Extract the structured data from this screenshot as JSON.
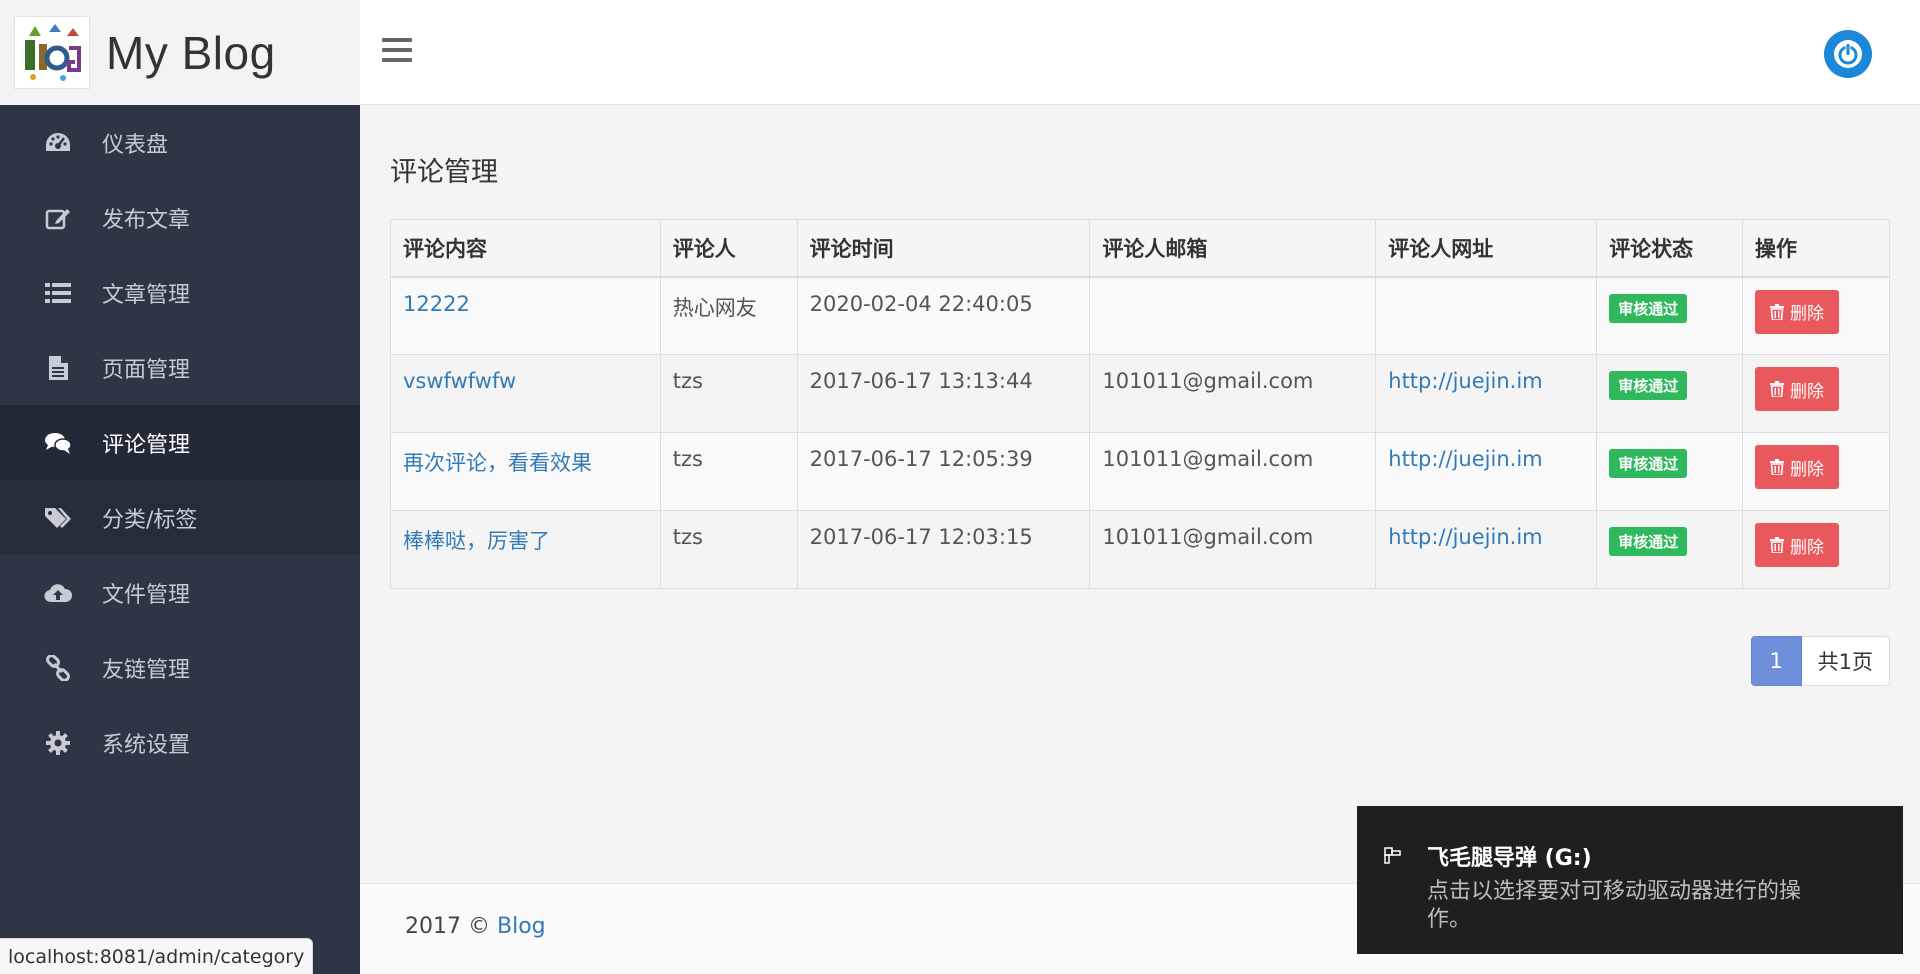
{
  "brand": {
    "name": "My Blog"
  },
  "sidebar": {
    "items": [
      {
        "label": "仪表盘",
        "icon": "dashboard-icon"
      },
      {
        "label": "发布文章",
        "icon": "edit-icon"
      },
      {
        "label": "文章管理",
        "icon": "list-icon"
      },
      {
        "label": "页面管理",
        "icon": "file-icon"
      },
      {
        "label": "评论管理",
        "icon": "comments-icon"
      },
      {
        "label": "分类/标签",
        "icon": "tags-icon"
      },
      {
        "label": "文件管理",
        "icon": "cloud-upload-icon"
      },
      {
        "label": "友链管理",
        "icon": "link-icon"
      },
      {
        "label": "系统设置",
        "icon": "gear-icon"
      }
    ]
  },
  "main": {
    "title": "评论管理",
    "table": {
      "headers": [
        "评论内容",
        "评论人",
        "评论时间",
        "评论人邮箱",
        "评论人网址",
        "评论状态",
        "操作"
      ],
      "rows": [
        {
          "content": "12222",
          "author": "热心网友",
          "time": "2020-02-04 22:40:05",
          "email": "",
          "url": "",
          "status": "审核通过",
          "action": "删除"
        },
        {
          "content": "vswfwfwfw",
          "author": "tzs",
          "time": "2017-06-17 13:13:44",
          "email": "101011@gmail.com",
          "url": "http://juejin.im",
          "status": "审核通过",
          "action": "删除"
        },
        {
          "content": "再次评论，看看效果",
          "author": "tzs",
          "time": "2017-06-17 12:05:39",
          "email": "101011@gmail.com",
          "url": "http://juejin.im",
          "status": "审核通过",
          "action": "删除"
        },
        {
          "content": "棒棒哒，厉害了",
          "author": "tzs",
          "time": "2017-06-17 12:03:15",
          "email": "101011@gmail.com",
          "url": "http://juejin.im",
          "status": "审核通过",
          "action": "删除"
        }
      ]
    },
    "pagination": {
      "current": "1",
      "total": "共1页"
    }
  },
  "footer": {
    "year": "2017 ©",
    "link": "Blog"
  },
  "status_bar": {
    "url": "localhost:8081/admin/category"
  },
  "toast": {
    "title": "飞毛腿导弹 (G:)",
    "message": "点击以选择要对可移动驱动器进行的操作。"
  },
  "colors": {
    "sidebar_bg": "#2e3544",
    "accent": "#337ab7",
    "badge": "#2fb85c",
    "danger": "#e9585c",
    "power": "#1e88d8"
  }
}
